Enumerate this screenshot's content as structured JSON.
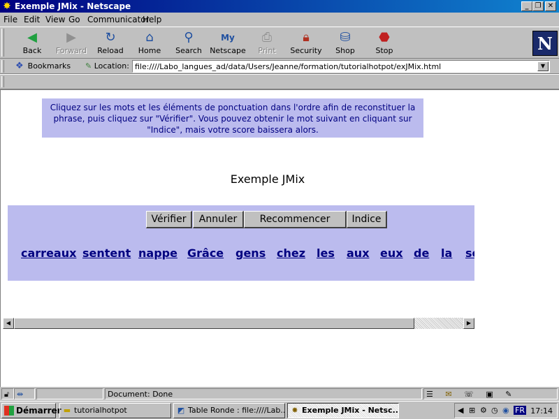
{
  "window": {
    "title": "Exemple JMix - Netscape"
  },
  "menu": [
    "File",
    "Edit",
    "View",
    "Go",
    "Communicator",
    "Help"
  ],
  "toolbar": {
    "back": "Back",
    "forward": "Forward",
    "reload": "Reload",
    "home": "Home",
    "search": "Search",
    "netscape": "Netscape",
    "print": "Print",
    "security": "Security",
    "shop": "Shop",
    "stop": "Stop"
  },
  "location": {
    "bookmarks": "Bookmarks",
    "label": "Location:",
    "url": "file:////Labo_langues_ad/data/Users/Jeanne/formation/tutorialhotpot/exJMix.html"
  },
  "page": {
    "instructions": "Cliquez sur les mots et les éléments de ponctuation dans l'ordre afin de reconstituer la phrase, puis cliquez sur \"Vérifier\". Vous pouvez obtenir le mot suivant en cliquant sur \"Indice\", mais votre score baissera alors.",
    "title": "Exemple JMix",
    "buttons": {
      "verify": "Vérifier",
      "undo": "Annuler",
      "restart": "Recommencer",
      "hint": "Indice"
    },
    "words": [
      "carreaux",
      "sentent",
      "nappe",
      "Grâce",
      "gens",
      "chez",
      "les",
      "aux",
      "eux",
      "de",
      "la",
      "se"
    ]
  },
  "status": {
    "text": "Document: Done"
  },
  "taskbar": {
    "start": "Démarrer",
    "tasks": [
      "tutorialhotpot",
      "Table Ronde : file:////Lab...",
      "Exemple JMix - Netsc..."
    ],
    "lang": "FR",
    "clock": "17:14"
  }
}
